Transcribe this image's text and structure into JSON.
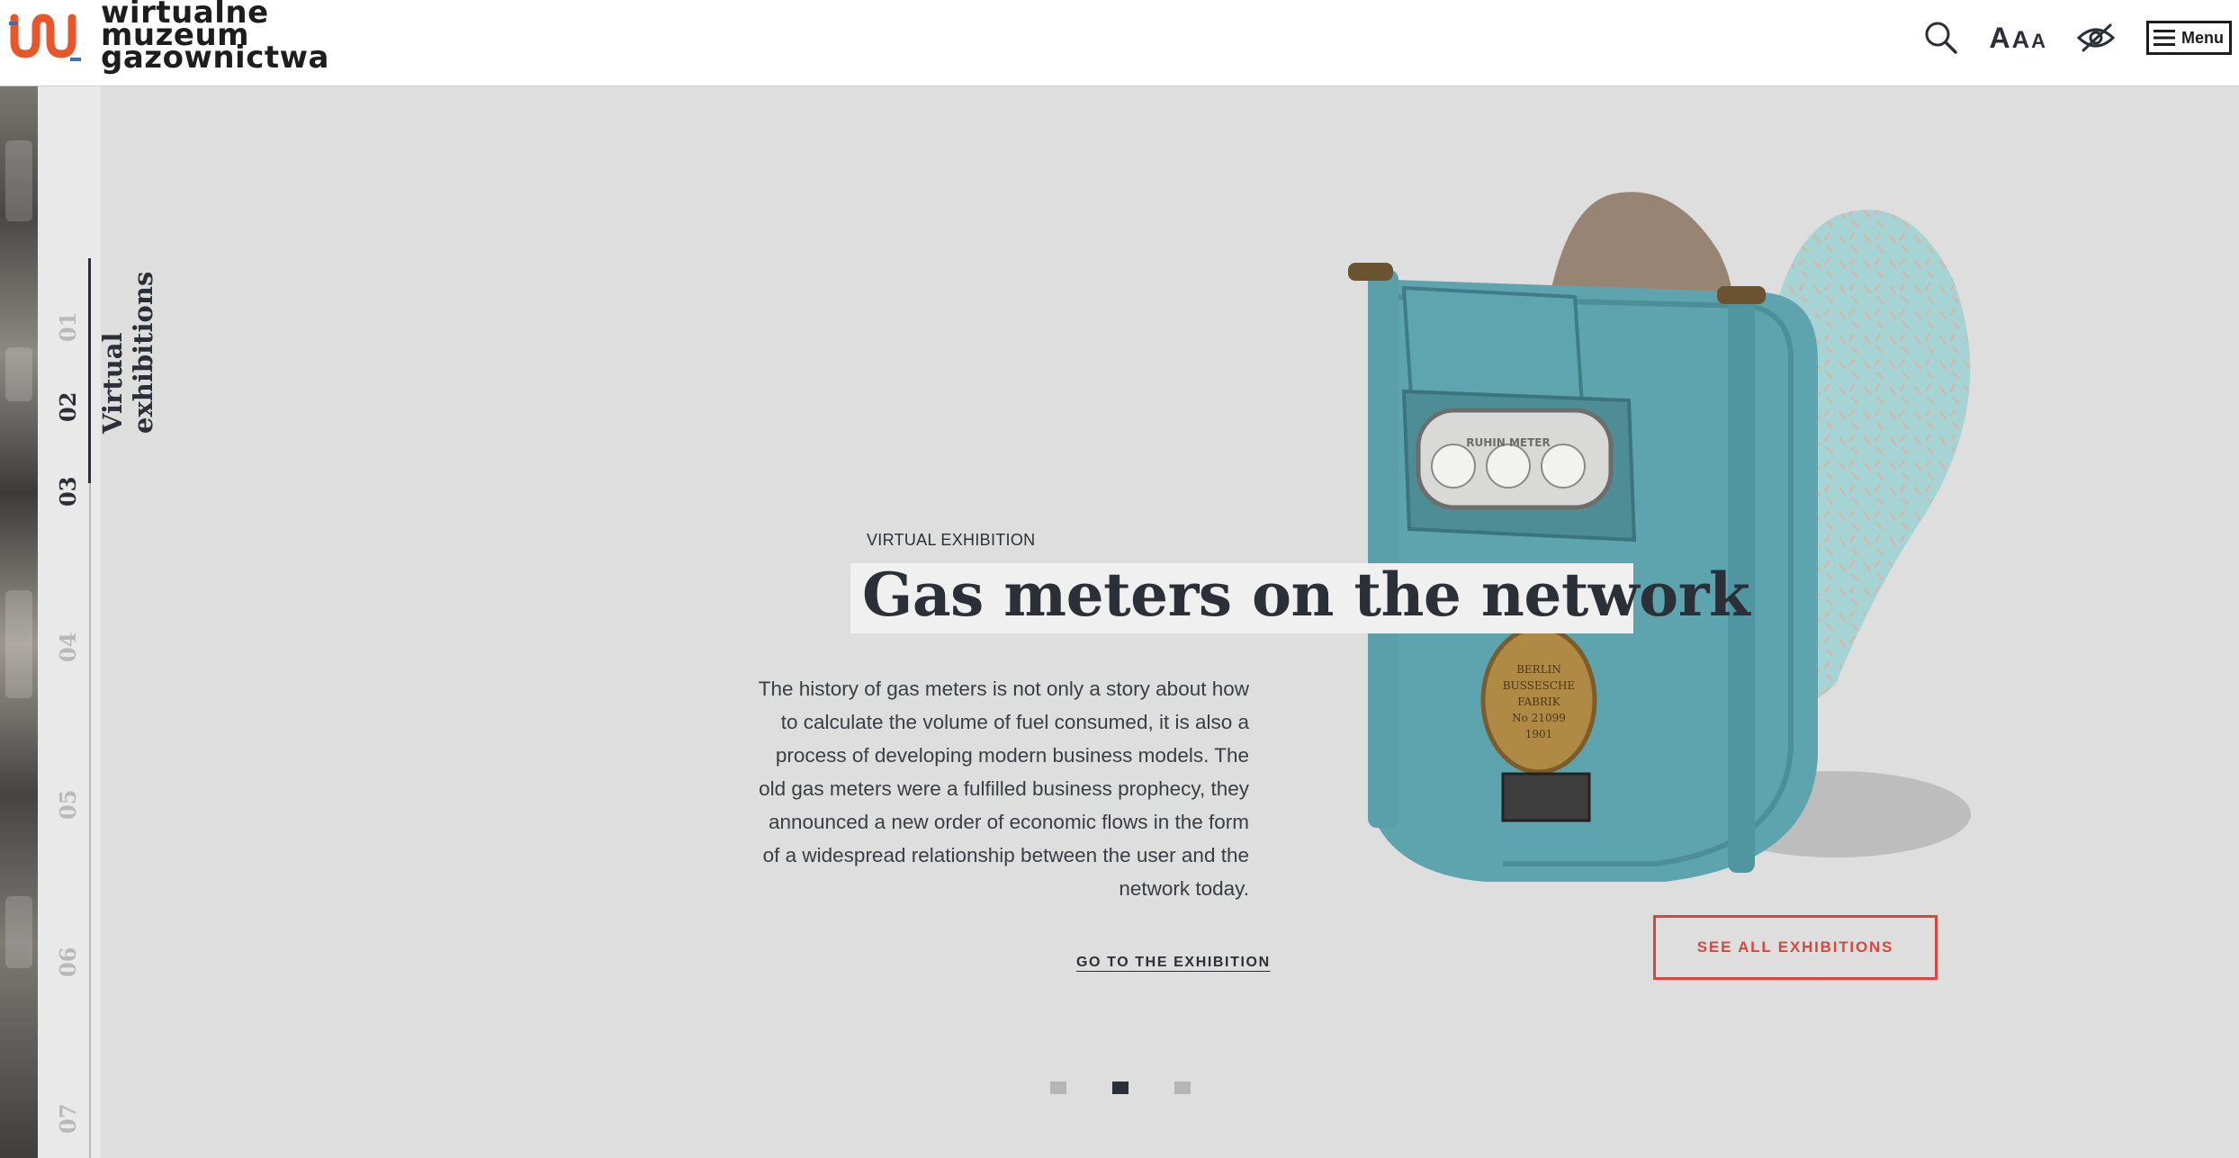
{
  "brand": {
    "logo_lines": [
      "wirtualne",
      "muzeum",
      "gazownictwa"
    ],
    "colors": {
      "accent": "#d9463e",
      "logo_orange": "#e8572b",
      "logo_blue": "#3d6fb6",
      "dark": "#2b2f38"
    }
  },
  "header": {
    "tools": {
      "search_icon": "search-icon",
      "font_size_label_parts": [
        "A",
        "A",
        "A"
      ],
      "contrast_icon": "eye-slash-icon",
      "menu_label": "Menu"
    }
  },
  "side_nav": {
    "numbers": [
      "01",
      "02",
      "03",
      "04",
      "05",
      "06",
      "07"
    ],
    "active": "02",
    "section_label_lines": [
      "Virtual",
      "exhibitions"
    ]
  },
  "slide": {
    "eyebrow": "VIRTUAL EXHIBITION",
    "title": "Gas meters on the network",
    "description": "The history of gas meters is not only a story about how to calculate the volume of fuel consumed, it is also a process of developing modern business models. The old gas meters were a fulfilled business prophecy, they announced a new order of economic flows in the form of a widespread relationship between the user and the network today.",
    "cta_link": "GO TO THE EXHIBITION",
    "see_all_button": "SEE ALL EXHIBITIONS",
    "meter_dial_label": "RUHIN METER",
    "meter_plate_lines": [
      "BERLIN",
      "BUSSESCHE",
      "FABRIK",
      "No 21099",
      "1901"
    ]
  },
  "pager": {
    "count": 3,
    "active_index": 1
  }
}
